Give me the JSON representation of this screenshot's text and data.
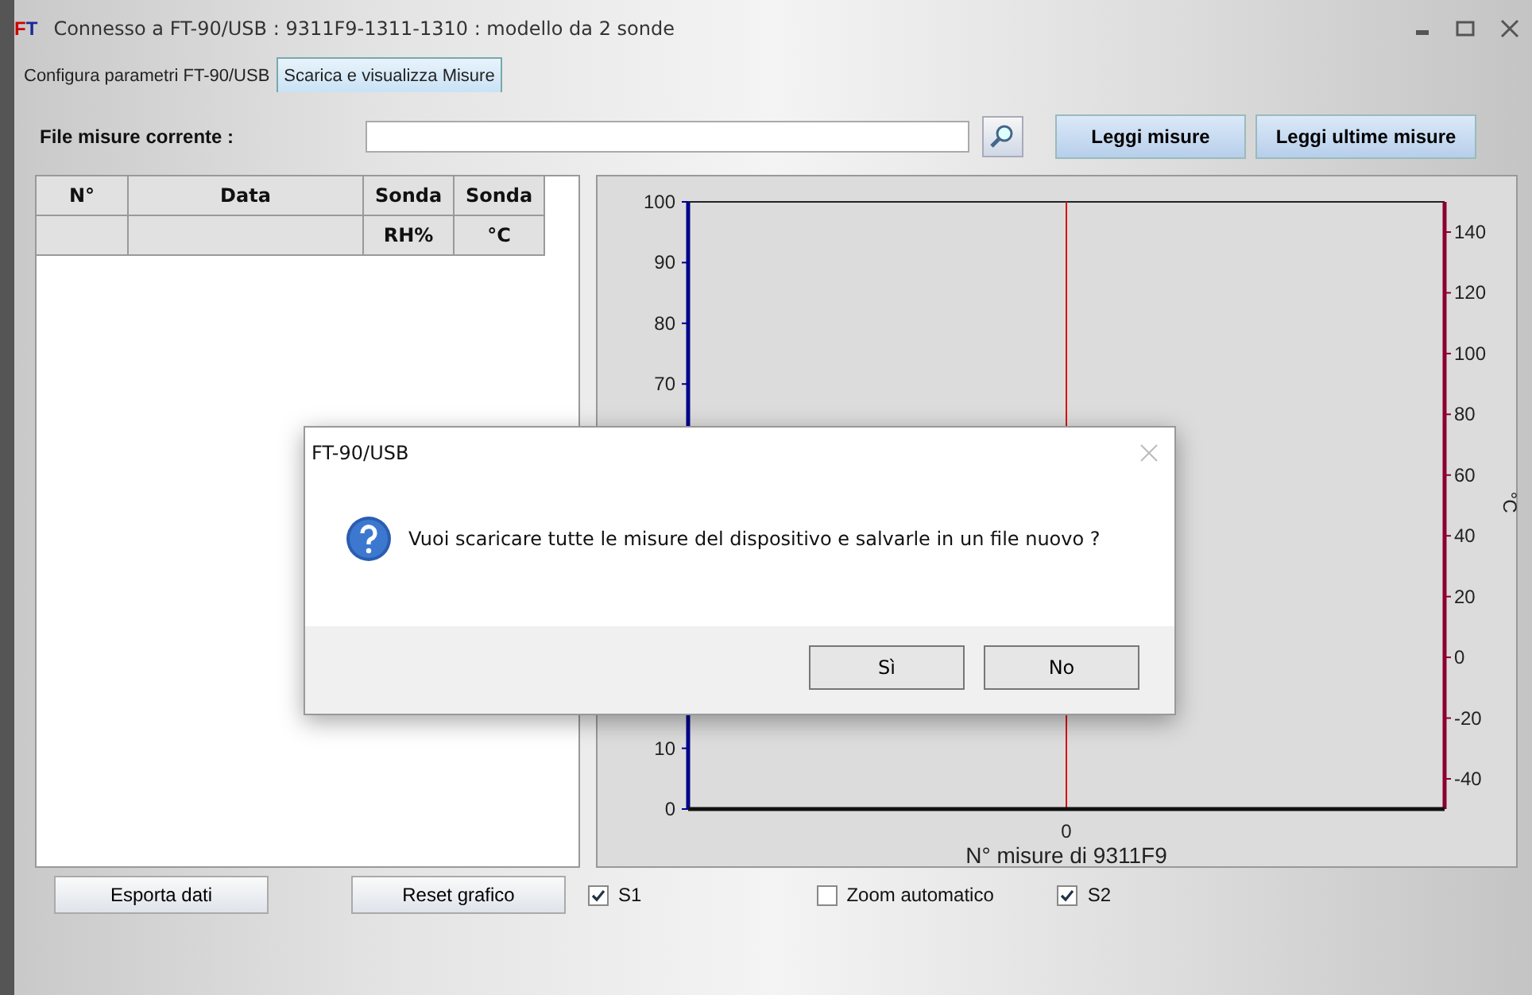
{
  "window": {
    "logo": "FT",
    "title": "Connesso a FT-90/USB : 9311F9-1311-1310 : modello da  2 sonde"
  },
  "tabs": [
    {
      "label": "Configura parametri FT-90/USB",
      "selected": false
    },
    {
      "label": "Scarica e visualizza Misure",
      "selected": true
    }
  ],
  "file_row": {
    "label": "File misure corrente :",
    "buttons": [
      "Leggi misure",
      "Leggi ultime misure"
    ]
  },
  "table": {
    "columns": [
      {
        "title": "N°"
      },
      {
        "title": "Data"
      },
      {
        "title": "Sonda",
        "unit": "RH%"
      },
      {
        "title": "Sonda",
        "unit": "°C"
      }
    ]
  },
  "chart": {
    "left_axis": {
      "ticks": [
        "100",
        "90",
        "80",
        "70",
        "10",
        "0"
      ]
    },
    "right_axis": {
      "label": "°C",
      "ticks": [
        "140",
        "120",
        "100",
        "80",
        "60",
        "40",
        "20",
        "0",
        "-20",
        "-40"
      ]
    },
    "x_axis": {
      "tick": "0",
      "label": "N° misure di 9311F9"
    }
  },
  "controls": [
    {
      "kind": "button",
      "label": "Esporta dati"
    },
    {
      "kind": "button",
      "label": "Reset grafico"
    },
    {
      "kind": "checkbox",
      "label": "S1",
      "checked": true
    },
    {
      "kind": "checkbox",
      "label": "Zoom automatico",
      "checked": false
    },
    {
      "kind": "checkbox",
      "label": "S2",
      "checked": true
    }
  ],
  "dialog": {
    "title": "FT-90/USB",
    "message": "Vuoi scaricare tutte le misure del dispositivo e salvarle in un file nuovo ?",
    "buttons": [
      "Sì",
      "No"
    ]
  }
}
